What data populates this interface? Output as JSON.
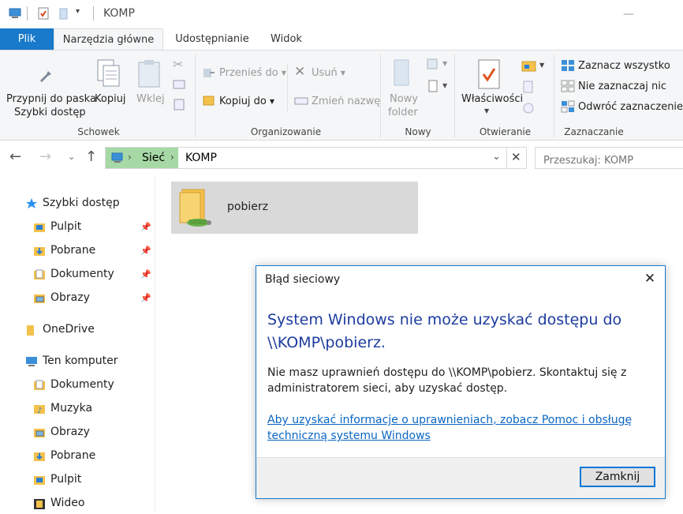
{
  "window": {
    "title": "KOMP",
    "minimize_glyph": "—"
  },
  "tabs": [
    "Plik",
    "Narzędzia główne",
    "Udostępnianie",
    "Widok"
  ],
  "ribbon": {
    "clipboard": {
      "pin": "Przypnij do paska",
      "pin2": "Szybki dostęp",
      "copy": "Kopiuj",
      "paste": "Wklej",
      "label": "Schowek"
    },
    "organize": {
      "move_to": "Przenieś do",
      "copy_to": "Kopiuj do",
      "delete": "Usuń",
      "rename": "Zmień nazwę",
      "label": "Organizowanie"
    },
    "new": {
      "new_folder_1": "Nowy",
      "new_folder_2": "folder",
      "label": "Nowy"
    },
    "open": {
      "properties": "Właściwości",
      "label": "Otwieranie"
    },
    "select": {
      "select_all": "Zaznacz wszystko",
      "select_none": "Nie zaznaczaj nic",
      "invert": "Odwróć zaznaczenie",
      "label": "Zaznaczanie"
    }
  },
  "address": {
    "seg1": "Sieć",
    "seg2": "KOMP",
    "search_placeholder": "Przeszukaj: KOMP"
  },
  "nav": {
    "quick_access": "Szybki dostęp",
    "qa_items": [
      "Pulpit",
      "Pobrane",
      "Dokumenty",
      "Obrazy"
    ],
    "onedrive": "OneDrive",
    "this_pc": "Ten komputer",
    "pc_items": [
      "Dokumenty",
      "Muzyka",
      "Obrazy",
      "Pobrane",
      "Pulpit",
      "Wideo"
    ]
  },
  "content": {
    "folder_name": "pobierz"
  },
  "dialog": {
    "title": "Błąd sieciowy",
    "close_glyph": "✕",
    "heading": "System Windows nie może uzyskać dostępu do \\\\KOMP\\pobierz.",
    "message": "Nie masz uprawnień dostępu do \\\\KOMP\\pobierz. Skontaktuj się z administratorem sieci, aby uzyskać dostęp.",
    "link": "Aby uzyskać informacje o uprawnieniach, zobacz Pomoc i obsługę techniczną systemu Windows",
    "button": "Zamknij"
  },
  "colors": {
    "accent": "#1979ca",
    "dialog_heading": "#1c3c9e",
    "link": "#0a66c2",
    "address_highlight": "#a6d9a6"
  }
}
